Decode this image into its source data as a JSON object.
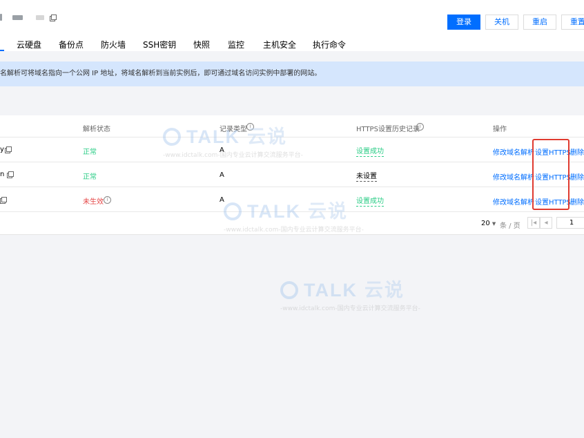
{
  "header": {
    "buttons": {
      "login": "登录",
      "shutdown": "关机",
      "restart": "重启",
      "reset": "重置"
    }
  },
  "tabs": [
    "云硬盘",
    "备份点",
    "防火墙",
    "SSH密钥",
    "快照",
    "监控",
    "主机安全",
    "执行命令"
  ],
  "notice": "名解析可将域名指向一个公网 IP 地址，将域名解析到当前实例后，即可通过域名访问实例中部署的网站。",
  "table": {
    "columns": {
      "status": "解析状态",
      "record_type": "记录类型",
      "https_history": "HTTPS设置历史记录",
      "actions": "操作"
    },
    "rows": [
      {
        "domain_tail": "y",
        "status": "正常",
        "record_type": "A",
        "https": "设置成功",
        "edit": "修改域名解析",
        "set_https": "设置HTTPS",
        "delete": "删除"
      },
      {
        "domain_tail": "n",
        "status": "正常",
        "record_type": "A",
        "https": "未设置",
        "edit": "修改域名解析",
        "set_https": "设置HTTPS",
        "delete": "删除"
      },
      {
        "domain_tail": "",
        "status": "未生效",
        "record_type": "A",
        "https": "设置成功",
        "edit": "修改域名解析",
        "set_https": "设置HTTPS",
        "delete": "删除"
      }
    ]
  },
  "pagination": {
    "page_size": "20",
    "page_size_unit": "条 / 页",
    "current_page": "1"
  },
  "watermark": {
    "logo": "TALK",
    "logo_cn": "云说",
    "subtitle": "-www.idctalk.com-国内专业云计算交流服务平台-"
  },
  "colors": {
    "primary": "#006eff",
    "success": "#29cc85",
    "danger": "#e54545",
    "highlight_box": "#e03a2f",
    "notice_bg": "#d5e6fd"
  }
}
